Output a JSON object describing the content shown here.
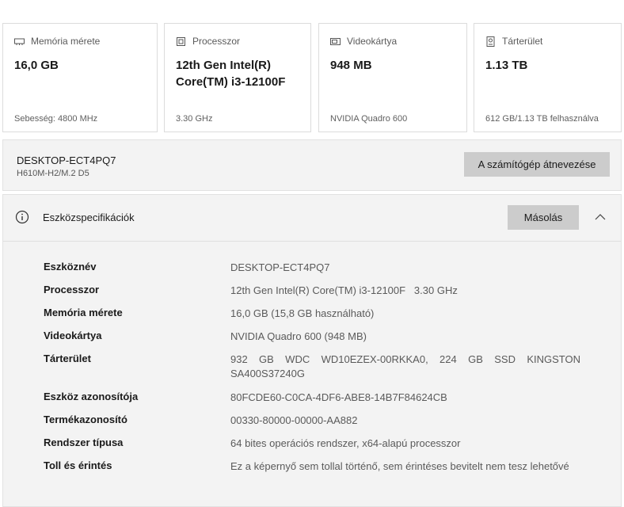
{
  "cards": [
    {
      "icon": "memory-icon",
      "title": "Memória mérete",
      "value": "16,0 GB",
      "sub": "Sebesség: 4800 MHz"
    },
    {
      "icon": "processor-icon",
      "title": "Processzor",
      "value": "12th Gen Intel(R) Core(TM) i3-12100F",
      "sub": "3.30 GHz"
    },
    {
      "icon": "graphics-card-icon",
      "title": "Videokártya",
      "value": "948 MB",
      "sub": "NVIDIA Quadro 600"
    },
    {
      "icon": "storage-icon",
      "title": "Tárterület",
      "value": "1.13 TB",
      "sub": "612 GB/1.13 TB felhasználva"
    }
  ],
  "pc": {
    "name": "DESKTOP-ECT4PQ7",
    "model": "H610M-H2/M.2 D5",
    "rename_label": "A számítógép átnevezése"
  },
  "specs": {
    "title": "Eszközspecifikációk",
    "copy_label": "Másolás",
    "rows": [
      {
        "label": "Eszköznév",
        "value": "DESKTOP-ECT4PQ7"
      },
      {
        "label": "Processzor",
        "value": "12th Gen Intel(R) Core(TM) i3-12100F   3.30 GHz"
      },
      {
        "label": "Memória mérete",
        "value": "16,0 GB (15,8 GB használható)"
      },
      {
        "label": "Videokártya",
        "value": "NVIDIA Quadro 600 (948 MB)"
      },
      {
        "label": "Tárterület",
        "value": "932 GB WDC WD10EZEX-00RKKA0, 224 GB SSD KINGSTON SA400S37240G"
      },
      {
        "label": "Eszköz azonosítója",
        "value": "80FCDE60-C0CA-4DF6-ABE8-14B7F84624CB"
      },
      {
        "label": "Termékazonosító",
        "value": "00330-80000-00000-AA882"
      },
      {
        "label": "Rendszer típusa",
        "value": "64 bites operációs rendszer, x64-alapú processzor"
      },
      {
        "label": "Toll és érintés",
        "value": "Ez a képernyő sem tollal történő, sem érintéses bevitelt nem tesz lehetővé"
      }
    ]
  }
}
